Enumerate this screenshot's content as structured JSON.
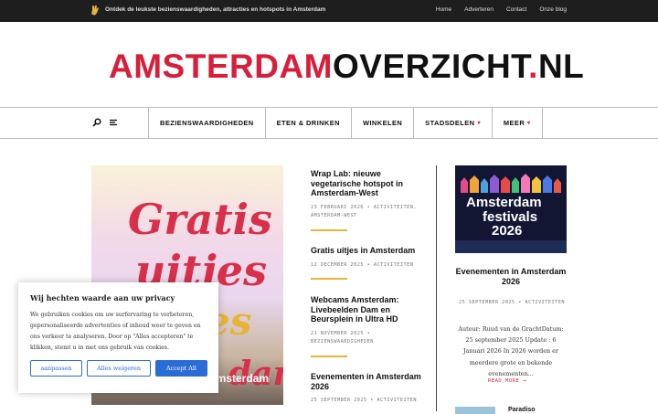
{
  "topbar": {
    "icon": "hand-icon",
    "tagline": "Ontdek de leukste bezienswaardigheden, attracties en hotspots in Amsterdam",
    "links": [
      "Home",
      "Adverteren",
      "Contact",
      "Onze blog"
    ]
  },
  "logo": {
    "part1": "AMSTERDAM",
    "part2": "OVERZICHT",
    "dot": ".",
    "part3": "NL",
    "color_accent": "#d71f3c"
  },
  "nav": {
    "search_icon": "search-icon",
    "menu_icon": "menu-icon",
    "items": [
      {
        "label": "BEZIENSWAARDIGHEDEN"
      },
      {
        "label": "ETEN & DRINKEN"
      },
      {
        "label": "WINKELEN"
      },
      {
        "label": "STADSDELEN",
        "caret": "▾"
      },
      {
        "label": "MEER",
        "caret": "▾"
      }
    ]
  },
  "hero": {
    "line1": "Gratis",
    "line2": "uitjes",
    "line3": "es",
    "line4": "dam",
    "caption": "Amsterdam"
  },
  "articles": [
    {
      "title": "Wrap Lab: nieuwe vegetarische hotspot in Amsterdam-West",
      "meta": "23 FEBRUARI 2026 • ACTIVITEITEN, AMSTERDAM-WEST"
    },
    {
      "title": "Gratis uitjes in Amsterdam",
      "meta": "12 DECEMBER 2025 • ACTIVITEITEN"
    },
    {
      "title": "Webcams Amsterdam: Livebeelden Dam en Beursplein in Ultra HD",
      "meta": "21 NOVEMBER 2025 • BEZIENSWAARDIGHEDEN"
    },
    {
      "title": "Evenementen in Amsterdam 2026",
      "meta": "25 SEPTEMBER 2025 • ACTIVITEITEN"
    }
  ],
  "featured": {
    "image_line1": "Amsterdam",
    "image_line2": "festivals",
    "image_line3": "2026",
    "title": "Evenementen in Amsterdam 2026",
    "meta": "25 SEPTEMBER 2025 • ACTIVITEITEN",
    "excerpt": "Auteur: Ruud van de GrachtDatum: 25 september 2025 Update : 6 Januari 2026 In 2026 worden er meerdere grote en bekende evenementen...",
    "read_more": "READ MORE",
    "next_title": "Paradiso"
  },
  "cookie": {
    "title": "Wij hechten waarde aan uw privacy",
    "body": "We gebruiken cookies om uw surfervaring te verbeteren, gepersonaliseerde advertenties of inhoud weer te geven en ons verkeer te analyseren. Door op \"Alles accepteren\" te klikken, stemt u in met ons gebruik van cookies.",
    "customize": "aanpassen",
    "reject": "Alles weigeren",
    "accept": "Accept All"
  }
}
